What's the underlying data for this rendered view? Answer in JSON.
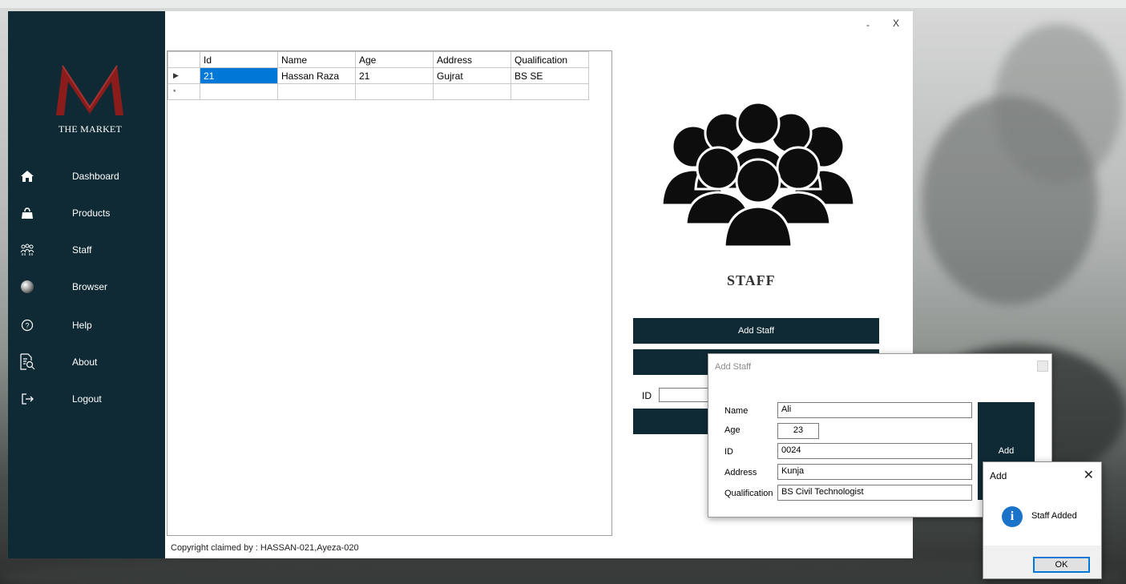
{
  "brand": {
    "logo_letter": "M",
    "name": "THE MARKET",
    "colors": {
      "sidebar": "#0f2a35",
      "logo_red": "#8b1c1c",
      "selection": "#0078d7"
    }
  },
  "window_controls": {
    "minimize": "-",
    "close": "X"
  },
  "nav": [
    {
      "label": "Dashboard",
      "icon": "home-icon"
    },
    {
      "label": "Products",
      "icon": "shopping-bag-icon"
    },
    {
      "label": "Staff",
      "icon": "people-icon"
    },
    {
      "label": "Browser",
      "icon": "globe-icon"
    },
    {
      "label": "Help",
      "icon": "help-icon"
    },
    {
      "label": "About",
      "icon": "document-search-icon"
    },
    {
      "label": "Logout",
      "icon": "logout-icon"
    }
  ],
  "grid": {
    "columns": [
      "Id",
      "Name",
      "Age",
      "Address",
      "Qualification"
    ],
    "rows": [
      {
        "marker": "▶",
        "cells": [
          "21",
          "Hassan Raza",
          "21",
          "Gujrat",
          "BS SE"
        ]
      },
      {
        "marker": "*",
        "cells": [
          "",
          "",
          "",
          "",
          ""
        ]
      }
    ]
  },
  "copyright": "Copyright claimed by : HASSAN-021,Ayeza-020",
  "staff_panel": {
    "title": "STAFF",
    "add_button": "Add Staff",
    "id_label": "ID",
    "id_value": ""
  },
  "add_dialog": {
    "title": "Add Staff",
    "fields": [
      {
        "label": "Name",
        "value": "Ali"
      },
      {
        "label": "Age",
        "value": "23"
      },
      {
        "label": "ID",
        "value": "0024"
      },
      {
        "label": "Address",
        "value": "Kunja"
      },
      {
        "label": "Qualification",
        "value": "BS Civil Technologist"
      }
    ],
    "add_button": "Add"
  },
  "message_box": {
    "title": "Add",
    "close": "✕",
    "icon_glyph": "i",
    "text": "Staff Added",
    "ok": "OK"
  }
}
